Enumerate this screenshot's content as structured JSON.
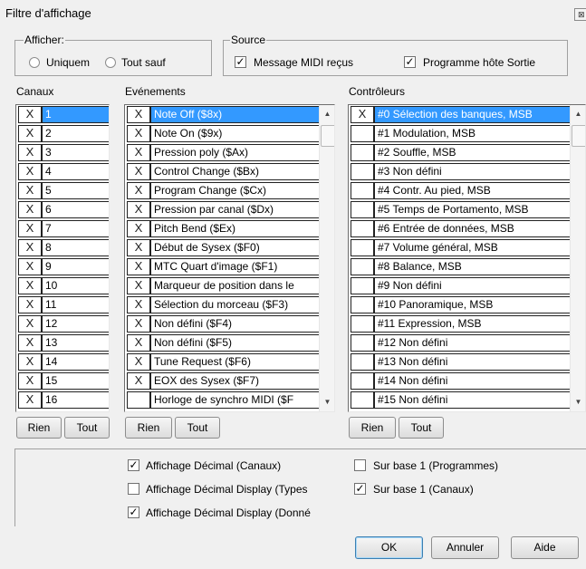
{
  "window": {
    "title": "Filtre d'affichage",
    "close_glyph": "⊠"
  },
  "afficher": {
    "legend": "Afficher:",
    "options": [
      {
        "label": "Uniquem",
        "checked": false
      },
      {
        "label": "Tout sauf",
        "checked": false
      }
    ]
  },
  "source": {
    "legend": "Source",
    "options": [
      {
        "label": "Message MIDI reçus",
        "checked": true
      },
      {
        "label": "Programme hôte Sortie",
        "checked": true
      }
    ]
  },
  "canaux": {
    "header": "Canaux",
    "rows": [
      {
        "mark": "X",
        "label": "1",
        "selected": true
      },
      {
        "mark": "X",
        "label": "2"
      },
      {
        "mark": "X",
        "label": "3"
      },
      {
        "mark": "X",
        "label": "4"
      },
      {
        "mark": "X",
        "label": "5"
      },
      {
        "mark": "X",
        "label": "6"
      },
      {
        "mark": "X",
        "label": "7"
      },
      {
        "mark": "X",
        "label": "8"
      },
      {
        "mark": "X",
        "label": "9"
      },
      {
        "mark": "X",
        "label": "10"
      },
      {
        "mark": "X",
        "label": "11"
      },
      {
        "mark": "X",
        "label": "12"
      },
      {
        "mark": "X",
        "label": "13"
      },
      {
        "mark": "X",
        "label": "14"
      },
      {
        "mark": "X",
        "label": "15"
      },
      {
        "mark": "X",
        "label": "16"
      }
    ],
    "btn_none": "Rien",
    "btn_all": "Tout"
  },
  "evenements": {
    "header": "Evénements",
    "rows": [
      {
        "mark": "X",
        "label": "Note Off ($8x)",
        "selected": true
      },
      {
        "mark": "X",
        "label": "Note On ($9x)"
      },
      {
        "mark": "X",
        "label": "Pression poly ($Ax)"
      },
      {
        "mark": "X",
        "label": "Control Change ($Bx)"
      },
      {
        "mark": "X",
        "label": "Program Change ($Cx)"
      },
      {
        "mark": "X",
        "label": "Pression par canal ($Dx)"
      },
      {
        "mark": "X",
        "label": "Pitch Bend ($Ex)"
      },
      {
        "mark": "X",
        "label": "Début de Sysex ($F0)"
      },
      {
        "mark": "X",
        "label": "MTC Quart d'image ($F1)"
      },
      {
        "mark": "X",
        "label": "Marqueur de position dans le"
      },
      {
        "mark": "X",
        "label": "Sélection du morceau ($F3)"
      },
      {
        "mark": "X",
        "label": "Non défini ($F4)"
      },
      {
        "mark": "X",
        "label": "Non défini ($F5)"
      },
      {
        "mark": "X",
        "label": "Tune Request ($F6)"
      },
      {
        "mark": "X",
        "label": "EOX des Sysex ($F7)"
      },
      {
        "mark": "",
        "label": "Horloge de synchro MIDI ($F"
      }
    ],
    "btn_none": "Rien",
    "btn_all": "Tout",
    "scroll_up": "▲",
    "scroll_down": "▼"
  },
  "controleurs": {
    "header": "Contrôleurs",
    "rows": [
      {
        "mark": "X",
        "label": "#0 Sélection des banques, MSB",
        "selected": true
      },
      {
        "mark": "",
        "label": "#1 Modulation, MSB"
      },
      {
        "mark": "",
        "label": "#2 Souffle, MSB"
      },
      {
        "mark": "",
        "label": "#3 Non défini"
      },
      {
        "mark": "",
        "label": "#4 Contr. Au pied, MSB"
      },
      {
        "mark": "",
        "label": "#5 Temps de Portamento, MSB"
      },
      {
        "mark": "",
        "label": "#6 Entrée de données, MSB"
      },
      {
        "mark": "",
        "label": "#7 Volume général, MSB"
      },
      {
        "mark": "",
        "label": "#8 Balance, MSB"
      },
      {
        "mark": "",
        "label": "#9 Non défini"
      },
      {
        "mark": "",
        "label": "#10 Panoramique, MSB"
      },
      {
        "mark": "",
        "label": "#11 Expression, MSB"
      },
      {
        "mark": "",
        "label": "#12 Non défini"
      },
      {
        "mark": "",
        "label": "#13 Non défini"
      },
      {
        "mark": "",
        "label": "#14 Non défini"
      },
      {
        "mark": "",
        "label": "#15 Non défini"
      }
    ],
    "btn_none": "Rien",
    "btn_all": "Tout",
    "scroll_up": "▲",
    "scroll_down": "▼"
  },
  "options": {
    "dec_canaux": {
      "label": "Affichage Décimal (Canaux)",
      "checked": true
    },
    "dec_types": {
      "label": "Affichage Décimal Display (Types",
      "checked": false
    },
    "dec_donnees": {
      "label": "Affichage Décimal Display (Donné",
      "checked": true
    },
    "base1_prog": {
      "label": "Sur base 1 (Programmes)",
      "checked": false
    },
    "base1_canaux": {
      "label": "Sur base 1 (Canaux)",
      "checked": true
    }
  },
  "buttons": {
    "ok": "OK",
    "cancel": "Annuler",
    "help": "Aide"
  },
  "colors": {
    "selection": "#3399ff",
    "background": "#f0f0f0"
  }
}
